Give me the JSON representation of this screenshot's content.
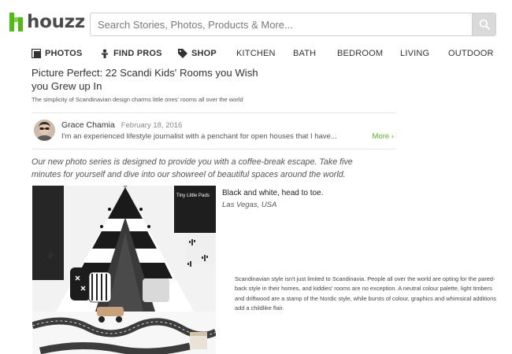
{
  "header": {
    "logo_text": "houzz",
    "brand_color": "#4dbc15",
    "search_placeholder": "Search Stories, Photos, Products & More...",
    "search_icon": "magnifier-icon"
  },
  "nav": {
    "items": [
      {
        "label": "PHOTOS",
        "icon": "photos-icon"
      },
      {
        "label": "FIND PROS",
        "icon": "find-pros-icon"
      },
      {
        "label": "SHOP",
        "icon": "tag-icon"
      },
      {
        "label": "KITCHEN"
      },
      {
        "label": "BATH"
      },
      {
        "label": "BEDROOM"
      },
      {
        "label": "LIVING"
      },
      {
        "label": "OUTDOOR"
      }
    ]
  },
  "article": {
    "title": "Picture Perfect: 22 Scandi Kids' Rooms you Wish you Grew up In",
    "subtitle": "The simplicity of Scandinavian design charms little ones' rooms all over the world",
    "author": {
      "name": "Grace Chamia",
      "date": "February 18, 2016",
      "bio": "I'm an experienced lifestyle journalist with a penchant for open houses that I have...",
      "more": "More ›"
    },
    "intro": "Our new photo series is designed to provide you with a coffee-break escape. Take five minutes for yourself and dive into our showreel of beautiful spaces around the world.",
    "photo": {
      "watermark": "Tiny Little Pads",
      "caption_title": "Black and white, head to toe.",
      "caption_location": "Las Vegas, USA"
    },
    "body": "Scandinavian style isn't just limited to Scandinavia. People all over the world are opting for the pared-back style in their homes, and kiddies' rooms are no exception. A neutral colour palette, light timbers and driftwood are a stamp of the Nordic style, while bursts of colour, graphics and whimsical additions add a childlike flair."
  }
}
